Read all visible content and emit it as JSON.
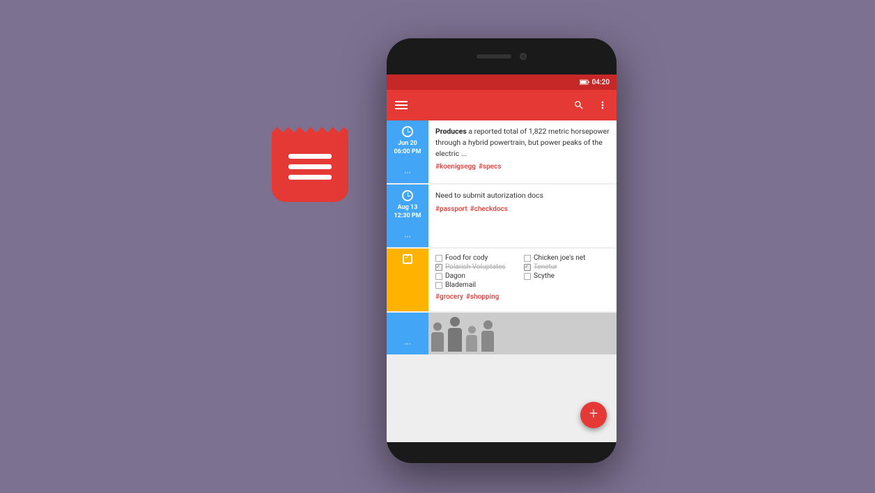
{
  "background": {
    "color": "#7d7191"
  },
  "app_icon": {
    "alt": "Keep Notes App Icon"
  },
  "phone": {
    "status_bar": {
      "time": "04:20"
    },
    "toolbar": {
      "menu_label": "Menu",
      "search_label": "Search",
      "more_label": "More options"
    },
    "notes": [
      {
        "id": "note1",
        "type": "text",
        "strip_color": "blue",
        "icon": "clock",
        "date": "Jun 20",
        "time": "06:00 PM",
        "text_bold": "Produces",
        "text_rest": " a reported total of 1,822 metric horsepower through a hybrid powertrain, but power peaks of the electric ...",
        "tags": [
          "#koenigsegg",
          "#specs"
        ]
      },
      {
        "id": "note2",
        "type": "text",
        "strip_color": "blue",
        "icon": "clock",
        "date": "Aug 13",
        "time": "12:30 PM",
        "text_plain": "Need to submit autorization docs",
        "tags": [
          "#passport",
          "#checkdocs"
        ]
      },
      {
        "id": "note3",
        "type": "checklist",
        "strip_color": "gold",
        "icon": "check",
        "items": [
          {
            "text": "Food for cody",
            "checked": false
          },
          {
            "text": "Chicken joe's net",
            "checked": false
          },
          {
            "text": "Polarish Voluptates",
            "checked": true
          },
          {
            "text": "Tenetur",
            "checked": true
          },
          {
            "text": "Dagon",
            "checked": false
          },
          {
            "text": "Scythe",
            "checked": false
          },
          {
            "text": "Blademail",
            "checked": false
          }
        ],
        "tags": [
          "#grocery",
          "#shopping"
        ]
      },
      {
        "id": "note4",
        "type": "image",
        "strip_color": "blue",
        "image_alt": "People at work"
      }
    ]
  }
}
